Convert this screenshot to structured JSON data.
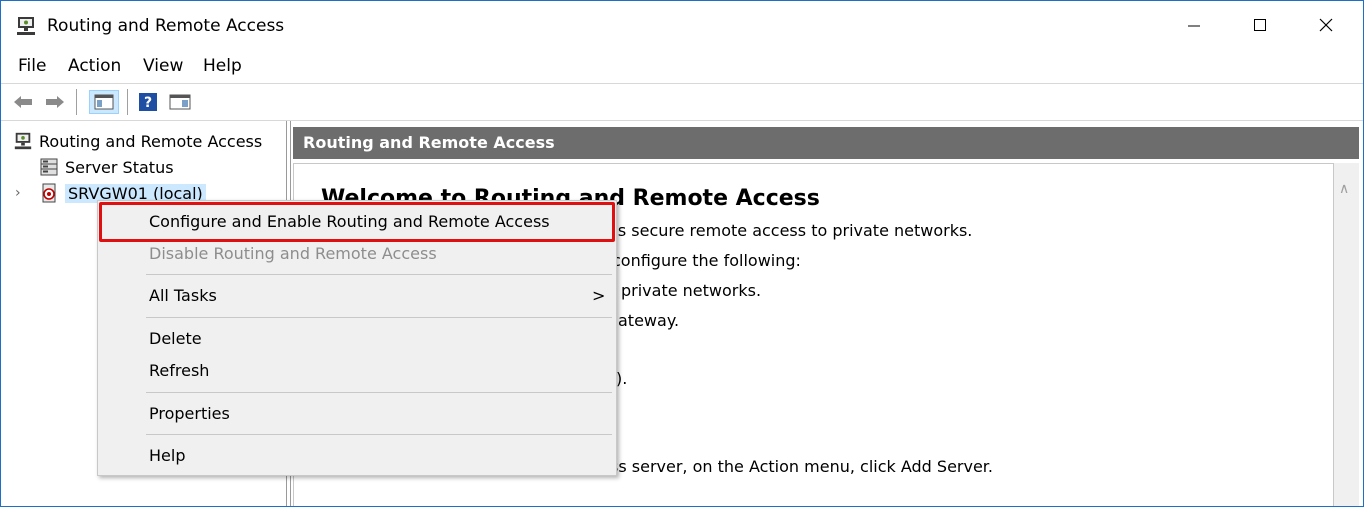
{
  "window": {
    "title": "Routing and Remote Access"
  },
  "menubar": {
    "file": "File",
    "action": "Action",
    "view": "View",
    "help": "Help"
  },
  "toolbar": {
    "back_icon": "back-arrow-icon",
    "forward_icon": "forward-arrow-icon",
    "console_tree_icon": "console-tree-icon",
    "help_icon": "help-icon",
    "action_pane_icon": "action-pane-icon"
  },
  "tree": {
    "root": "Routing and Remote Access",
    "server_status": "Server Status",
    "server": "SRVGW01 (local)"
  },
  "right_pane": {
    "header": "Routing and Remote Access",
    "welcome_title": "Welcome to Routing and Remote Access",
    "lines": [
      "es secure remote access to private networks.",
      "configure the following:",
      "private networks.",
      "ateway.",
      ").",
      "ss server, on the Action menu, click Add Server."
    ]
  },
  "context_menu": {
    "items": [
      "Configure and Enable Routing and Remote Access",
      "Disable Routing and Remote Access",
      "All Tasks",
      "Delete",
      "Refresh",
      "Properties",
      "Help"
    ],
    "submenu_arrow": ">"
  },
  "colors": {
    "header_bg": "#6d6d6d",
    "highlight": "#e11010",
    "selection": "#cce8ff"
  }
}
